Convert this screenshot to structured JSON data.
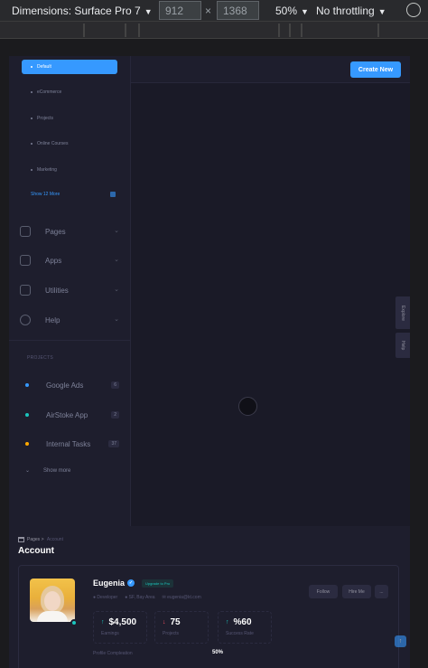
{
  "devtools": {
    "dimensions_label": "Dimensions: Surface Pro 7",
    "width": "912",
    "height": "1368",
    "zoom": "50%",
    "throttling": "No throttling"
  },
  "header": {
    "create_button": "Create New"
  },
  "sidebar": {
    "dashboards": [
      {
        "label": "Default",
        "active": true
      },
      {
        "label": "eCommerce"
      },
      {
        "label": "Projects"
      },
      {
        "label": "Online Courses"
      },
      {
        "label": "Marketing"
      }
    ],
    "show_more": "Show 12 More",
    "menu": [
      {
        "label": "Pages",
        "icon": "chart-icon"
      },
      {
        "label": "Apps",
        "icon": "bag-icon"
      },
      {
        "label": "Utilities",
        "icon": "pulse-icon"
      },
      {
        "label": "Help",
        "icon": "gear-icon"
      }
    ],
    "projects_title": "PROJECTS",
    "projects": [
      {
        "label": "Google Ads",
        "count": "6",
        "color": "#3699ff"
      },
      {
        "label": "AirStoke App",
        "count": "2",
        "color": "#1bc5bd"
      },
      {
        "label": "Internal Tasks",
        "count": "37",
        "color": "#ffa800"
      }
    ],
    "show_more_projects": "Show more"
  },
  "side_tabs": [
    "Explore",
    "Help"
  ],
  "breadcrumb": {
    "section": "Pages",
    "current": "Account"
  },
  "page_title": "Account",
  "profile": {
    "name": "Eugenia",
    "badge": "Upgrade to Pro",
    "meta": [
      "Developer",
      "SF, Bay Area",
      "eugenia@kt.com"
    ],
    "follow": "Follow",
    "hire": "Hire Me",
    "more": "...",
    "stats": [
      {
        "value": "$4,500",
        "label": "Earnings",
        "trend": "up"
      },
      {
        "value": "75",
        "label": "Projects",
        "trend": "down"
      },
      {
        "value": "%60",
        "label": "Success Rate",
        "trend": "up"
      }
    ],
    "progress_label": "Profile Compleation",
    "progress_value": "50%"
  }
}
